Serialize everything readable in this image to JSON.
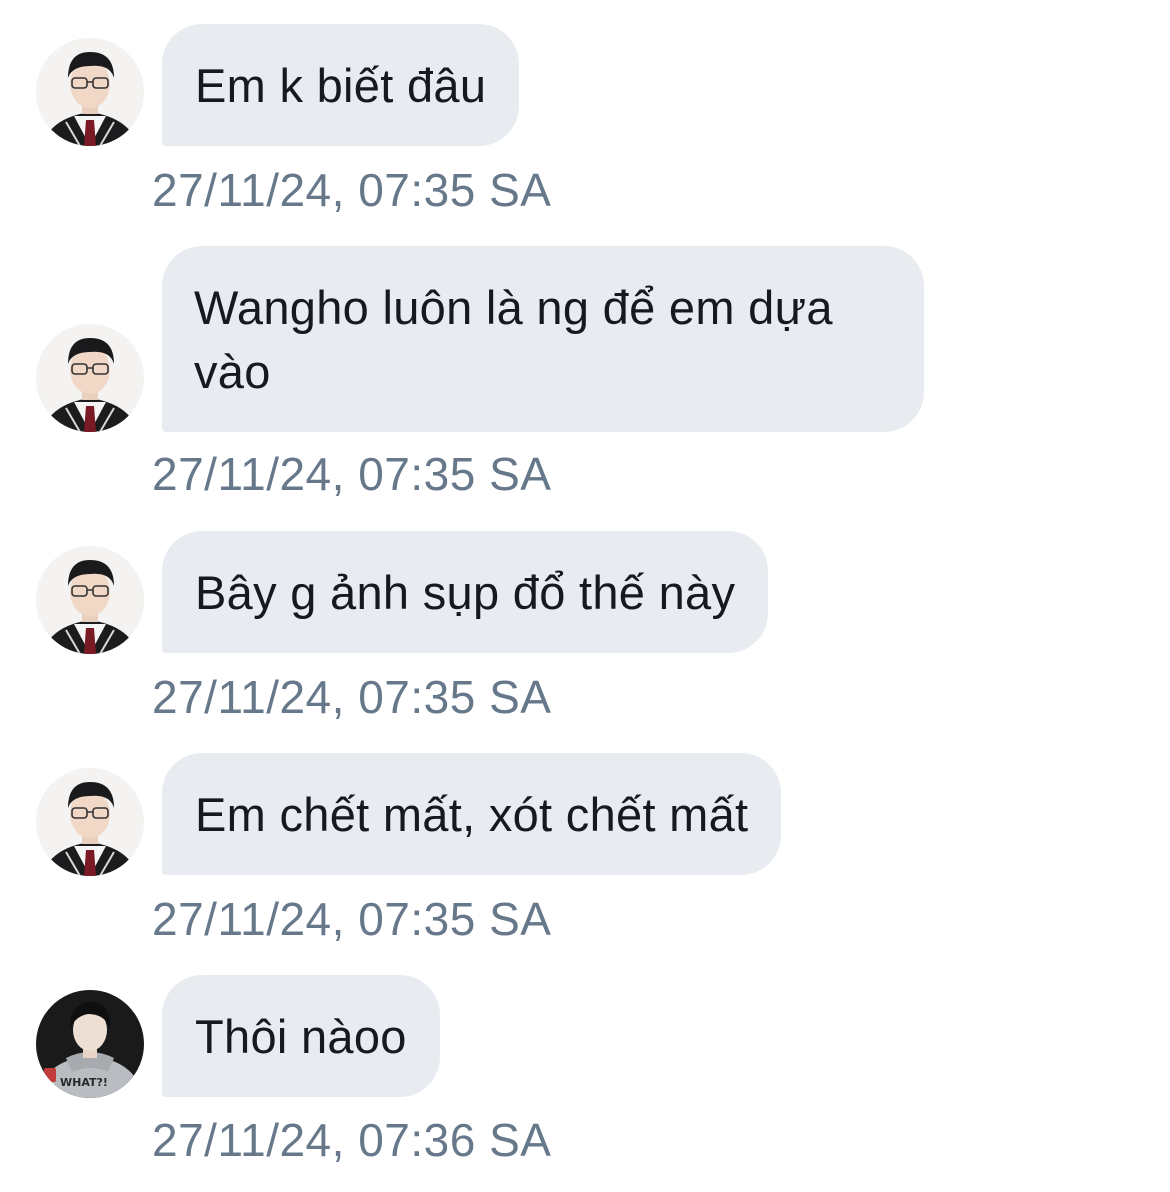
{
  "conversation": {
    "messages": [
      {
        "sender": "contact-a",
        "text": "Em k biết đâu",
        "timestamp": "27/11/24, 07:35 SA"
      },
      {
        "sender": "contact-a",
        "text": "Wangho luôn là ng để em dựa vào",
        "timestamp": "27/11/24, 07:35 SA"
      },
      {
        "sender": "contact-a",
        "text": "Bây g ảnh sụp đổ thế này",
        "timestamp": "27/11/24, 07:35 SA"
      },
      {
        "sender": "contact-a",
        "text": "Em chết mất, xót chết mất",
        "timestamp": "27/11/24, 07:35 SA"
      },
      {
        "sender": "contact-b",
        "text": "Thôi nàoo",
        "timestamp": "27/11/24, 07:36 SA"
      }
    ]
  },
  "colors": {
    "bubble_bg": "#e8ecf0",
    "text": "#141a20",
    "timestamp": "#66788a",
    "background": "#ffffff"
  },
  "icons": {
    "avatar_a": "profile-photo-glasses-uniform",
    "avatar_b": "profile-photo-grey-hoodie"
  }
}
